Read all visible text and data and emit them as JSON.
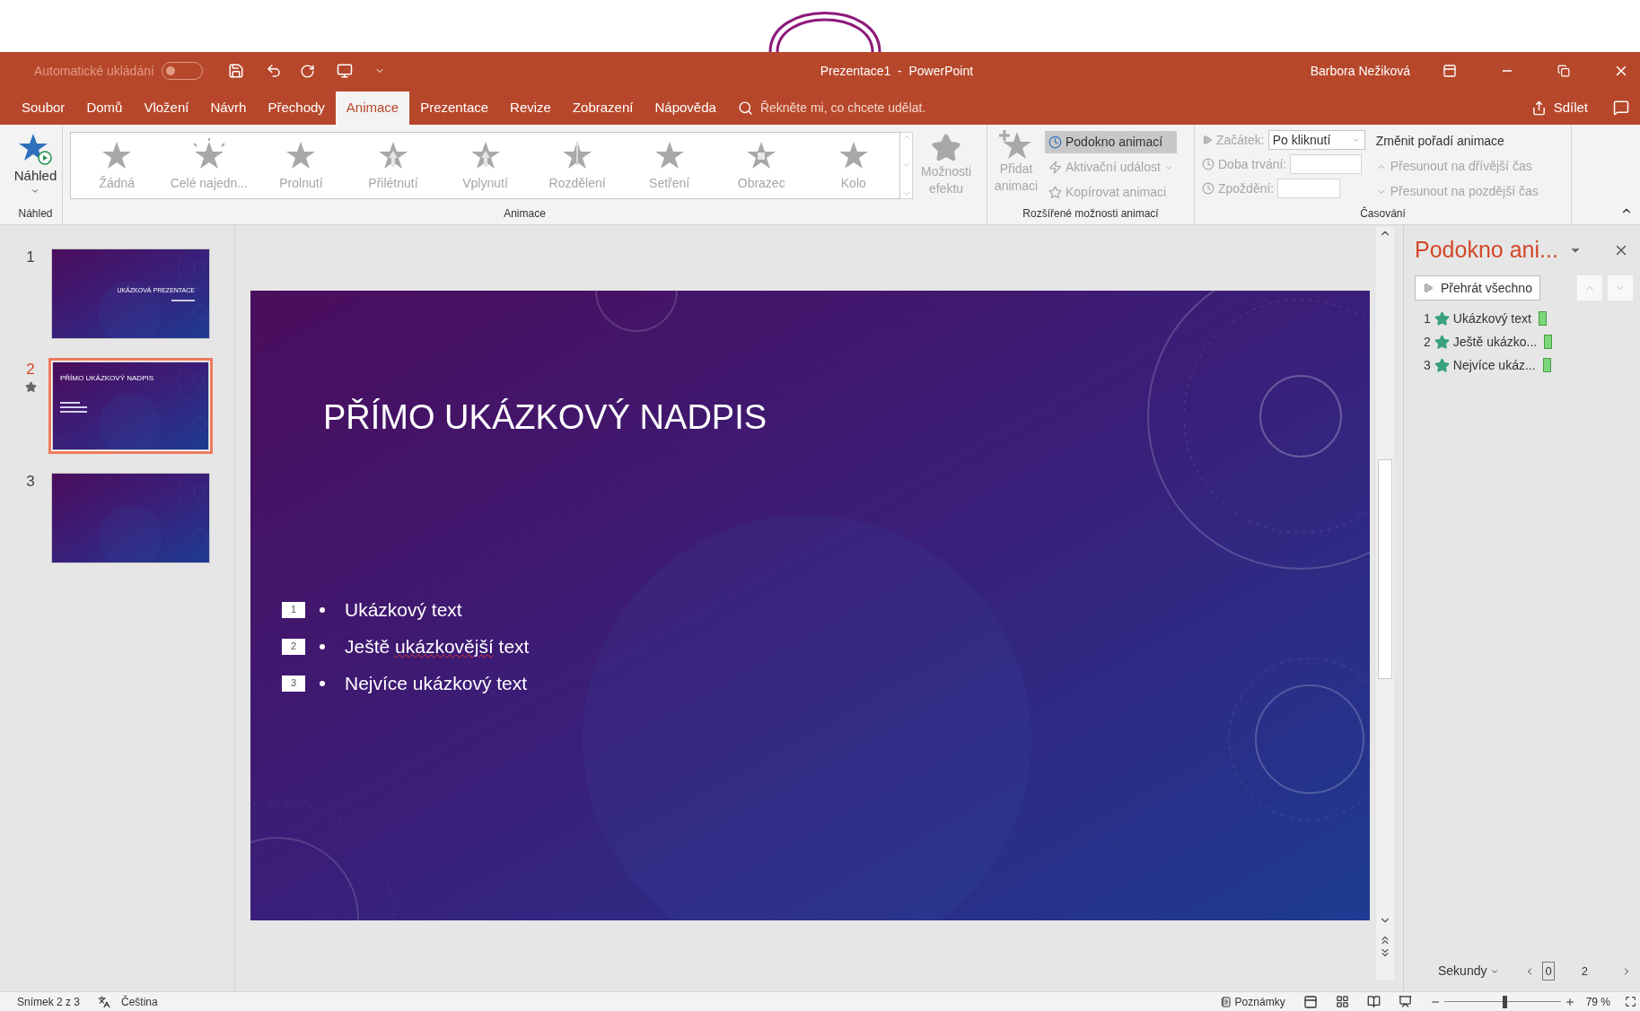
{
  "window": {
    "title": "Prezentace1  -  PowerPoint",
    "user": "Barbora Nežiková",
    "autosave": {
      "label": "Automatické ukládání",
      "on": false
    }
  },
  "tabs": [
    {
      "label": "Soubor",
      "selected": false
    },
    {
      "label": "Domů",
      "selected": false
    },
    {
      "label": "Vložení",
      "selected": false
    },
    {
      "label": "Návrh",
      "selected": false
    },
    {
      "label": "Přechody",
      "selected": false
    },
    {
      "label": "Animace",
      "selected": true
    },
    {
      "label": "Prezentace",
      "selected": false
    },
    {
      "label": "Revize",
      "selected": false
    },
    {
      "label": "Zobrazení",
      "selected": false
    },
    {
      "label": "Nápověda",
      "selected": false
    }
  ],
  "search": {
    "placeholder": "Řekněte mi, co chcete udělat."
  },
  "share": "Sdílet",
  "ribbon": {
    "preview": {
      "label": "Náhled",
      "group": "Náhled"
    },
    "gallery": {
      "group": "Animace",
      "items": [
        {
          "label": "Žádná",
          "kind": "none"
        },
        {
          "label": "Celé najedn...",
          "kind": "burst"
        },
        {
          "label": "Prolnutí",
          "kind": "star"
        },
        {
          "label": "Přilétnutí",
          "kind": "fly"
        },
        {
          "label": "Vplynutí",
          "kind": "fly"
        },
        {
          "label": "Rozdělení",
          "kind": "split"
        },
        {
          "label": "Setření",
          "kind": "star"
        },
        {
          "label": "Obrazec",
          "kind": "shape"
        },
        {
          "label": "Kolo",
          "kind": "star"
        }
      ]
    },
    "effect_options": {
      "label": "Možnosti efektu",
      "disabled": true
    },
    "advanced": {
      "group": "Rozšířené možnosti animací",
      "add": {
        "label": "Přidat animaci",
        "disabled": true
      },
      "items": [
        {
          "label": "Podokno animací",
          "selected": true,
          "disabled": false
        },
        {
          "label": "Aktivační událost",
          "selected": false,
          "disabled": true
        },
        {
          "label": "Kopírovat animaci",
          "selected": false,
          "disabled": true
        }
      ]
    },
    "timing": {
      "group": "Časování",
      "start": {
        "label": "Začátek:",
        "value": "Po kliknutí"
      },
      "duration": {
        "label": "Doba trvání:"
      },
      "delay": {
        "label": "Zpoždění:"
      },
      "reorder": {
        "title": "Změnit pořadí animace",
        "earlier": "Přesunout na dřívější čas",
        "later": "Přesunout na pozdější čas"
      }
    }
  },
  "slides": [
    {
      "number": "1",
      "selected": false,
      "animated": false,
      "title": "UKÁZKOVÁ PREZENTACE",
      "kind": "title"
    },
    {
      "number": "2",
      "selected": true,
      "animated": true,
      "title": "PŘÍMO UKÁZKOVÝ NADPIS",
      "kind": "content"
    },
    {
      "number": "3",
      "selected": false,
      "animated": false,
      "kind": "blank"
    }
  ],
  "current_slide": {
    "title": "PŘÍMO UKÁZKOVÝ NADPIS",
    "bullets": [
      {
        "marker": "1",
        "parts": [
          {
            "text": "Ukázkový text",
            "misspelled": false
          }
        ]
      },
      {
        "marker": "2",
        "parts": [
          {
            "text": "Ještě ",
            "misspelled": false
          },
          {
            "text": "ukázkovější",
            "misspelled": true
          },
          {
            "text": " text",
            "misspelled": false
          }
        ]
      },
      {
        "marker": "3",
        "parts": [
          {
            "text": "Nejvíce ukázkový text",
            "misspelled": false
          }
        ]
      }
    ]
  },
  "animation_pane": {
    "title": "Podokno ani...",
    "play": "Přehrát všechno",
    "items": [
      {
        "number": "1",
        "label": "Ukázkový text"
      },
      {
        "number": "2",
        "label": "Ještě ukázko..."
      },
      {
        "number": "3",
        "label": "Nejvíce ukáz..."
      }
    ],
    "units": "Sekundy",
    "timeline": [
      "0",
      "2"
    ]
  },
  "status_bar": {
    "slide": "Snímek 2 z 3",
    "language": "Čeština",
    "notes": "Poznámky",
    "zoom": "79 %",
    "zoom_slider": {
      "level": 0.5
    }
  }
}
